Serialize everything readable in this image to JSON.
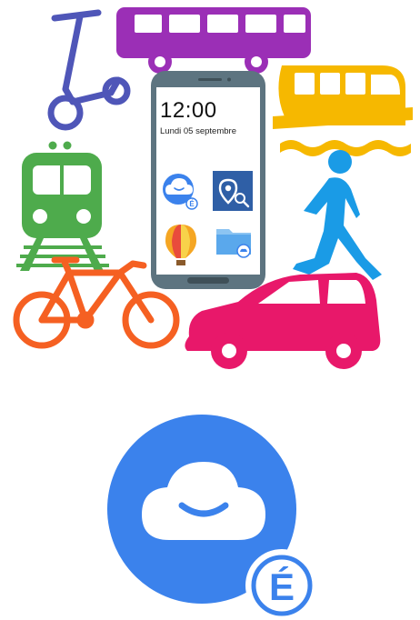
{
  "phone": {
    "time": "12:00",
    "date": "Lundi 05 septembre",
    "apps": [
      {
        "icon": "cloud-smile-badge-icon"
      },
      {
        "icon": "map-pin-search-icon"
      },
      {
        "icon": "hot-air-balloon-icon"
      },
      {
        "icon": "folder-cloud-icon"
      }
    ]
  },
  "transport_icons": [
    "scooter-icon",
    "bus-icon",
    "ferry-icon",
    "train-icon",
    "pedestrian-icon",
    "bicycle-icon",
    "car-icon"
  ],
  "logo": {
    "icon": "cloud-smile-e-badge-icon",
    "badge_letter": "É"
  },
  "colors": {
    "scooter": "#4f56b8",
    "bus": "#9b2fb6",
    "ferry": "#f6b800",
    "train": "#4eab4c",
    "pedestrian": "#1a9be6",
    "bicycle": "#f56022",
    "car": "#e8186a",
    "phone_body": "#5d7480",
    "logo_blue": "#3b82ec"
  }
}
